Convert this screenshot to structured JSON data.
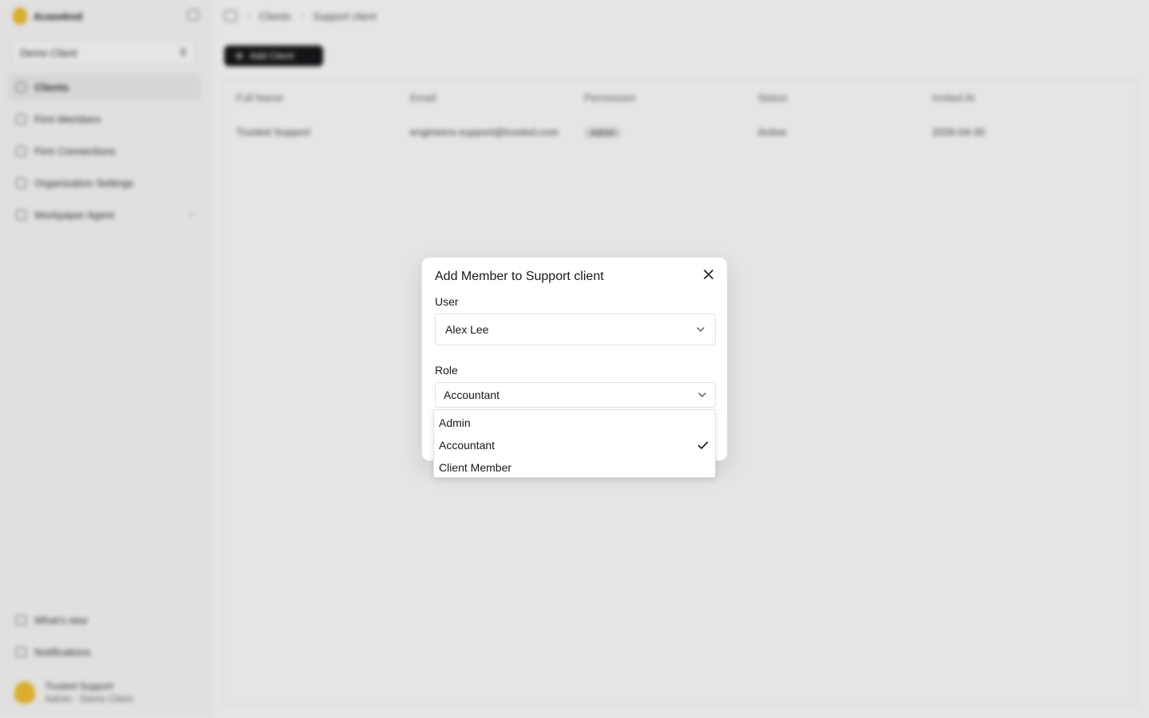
{
  "sidebar": {
    "brand": "Acaseknd",
    "client_selector": "Demo Client",
    "items": [
      {
        "label": "Clients",
        "icon": "building-icon"
      },
      {
        "label": "Firm Members",
        "icon": "user-icon"
      },
      {
        "label": "Firm Connections",
        "icon": "link-icon"
      },
      {
        "label": "Organization Settings",
        "icon": "settings-icon"
      },
      {
        "label": "Workpaper Agent",
        "icon": "agent-icon"
      }
    ],
    "bottom_items": [
      {
        "label": "What's new",
        "icon": "sparkle-icon"
      },
      {
        "label": "Notifications",
        "icon": "bell-icon"
      }
    ],
    "footer": {
      "name": "Trusted Support",
      "subtitle": "Admin · Demo Client"
    }
  },
  "header": {
    "breadcrumbs": [
      "Clients",
      "Support client"
    ]
  },
  "toolbar": {
    "add_client_label": "Add Client"
  },
  "table": {
    "columns": [
      "Full Name",
      "Email",
      "Permission",
      "Status",
      "Invited At"
    ],
    "rows": [
      {
        "name": "Trusted Support",
        "email": "engineers-support@trusted.com",
        "permission": "Admin",
        "status": "Active",
        "invited_at": "2026-04-30"
      }
    ]
  },
  "dialog": {
    "title": "Add Member to Support client",
    "user_label": "User",
    "user_value": "Alex Lee",
    "role_label": "Role",
    "role_value": "Accountant",
    "role_options": [
      {
        "label": "Admin",
        "selected": false
      },
      {
        "label": "Accountant",
        "selected": true
      },
      {
        "label": "Client Member",
        "selected": false
      }
    ]
  }
}
